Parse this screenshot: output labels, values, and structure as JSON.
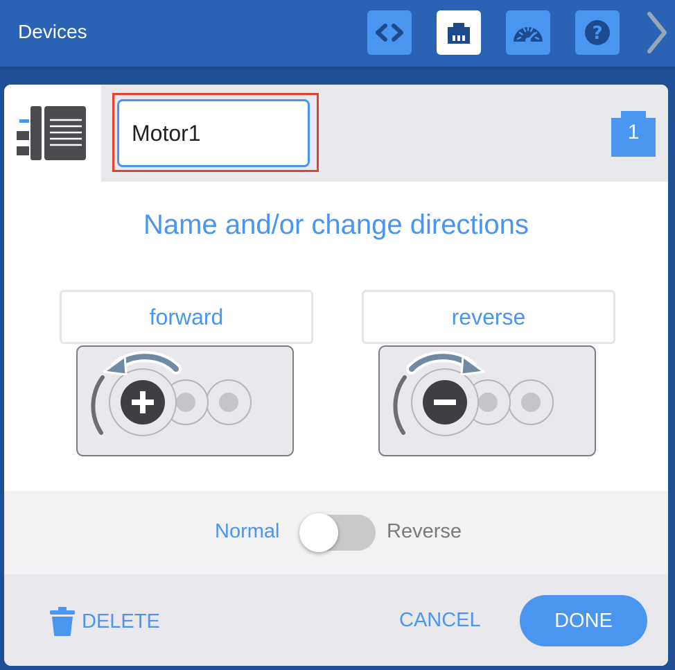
{
  "topbar": {
    "title": "Devices",
    "buttons": [
      {
        "icon": "code-icon",
        "active": false
      },
      {
        "icon": "devices-brain-icon",
        "active": true
      },
      {
        "icon": "dashboard-gauge-icon",
        "active": false
      },
      {
        "icon": "help-icon",
        "active": false
      }
    ],
    "next_icon": "chevron-right-icon"
  },
  "dialog": {
    "device_icon": "motor-device-icon",
    "name_input": {
      "value": "Motor1"
    },
    "port": {
      "number": "1",
      "icon": "port-badge-icon"
    },
    "heading": "Name and/or change directions",
    "directions": {
      "forward_label": "forward",
      "reverse_label": "reverse"
    },
    "toggle": {
      "normal_label": "Normal",
      "reverse_label": "Reverse",
      "state": "Normal"
    },
    "footer": {
      "delete_label": "DELETE",
      "cancel_label": "CANCEL",
      "done_label": "DONE"
    }
  },
  "colors": {
    "accent": "#4a95ef",
    "topbar": "#2a63b4",
    "highlight": "#e8402d"
  }
}
